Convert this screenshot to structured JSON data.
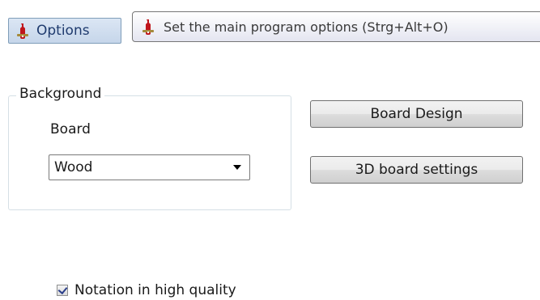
{
  "toolbar": {
    "options_label": "Options",
    "options_icon": "wrench-icon"
  },
  "tooltip": {
    "text": "Set the main program options (Strg+Alt+O)",
    "icon": "wrench-icon"
  },
  "background_group": {
    "title": "Background",
    "board_label": "Board",
    "board_selected": "Wood"
  },
  "buttons": {
    "board_design": "Board Design",
    "board_3d_settings": "3D board settings"
  },
  "notation": {
    "label": "Notation in high quality",
    "checked": true
  },
  "colors": {
    "accent": "#c6d6ea",
    "wrench_red": "#c0161c",
    "check_mark": "#2b3f8a"
  }
}
